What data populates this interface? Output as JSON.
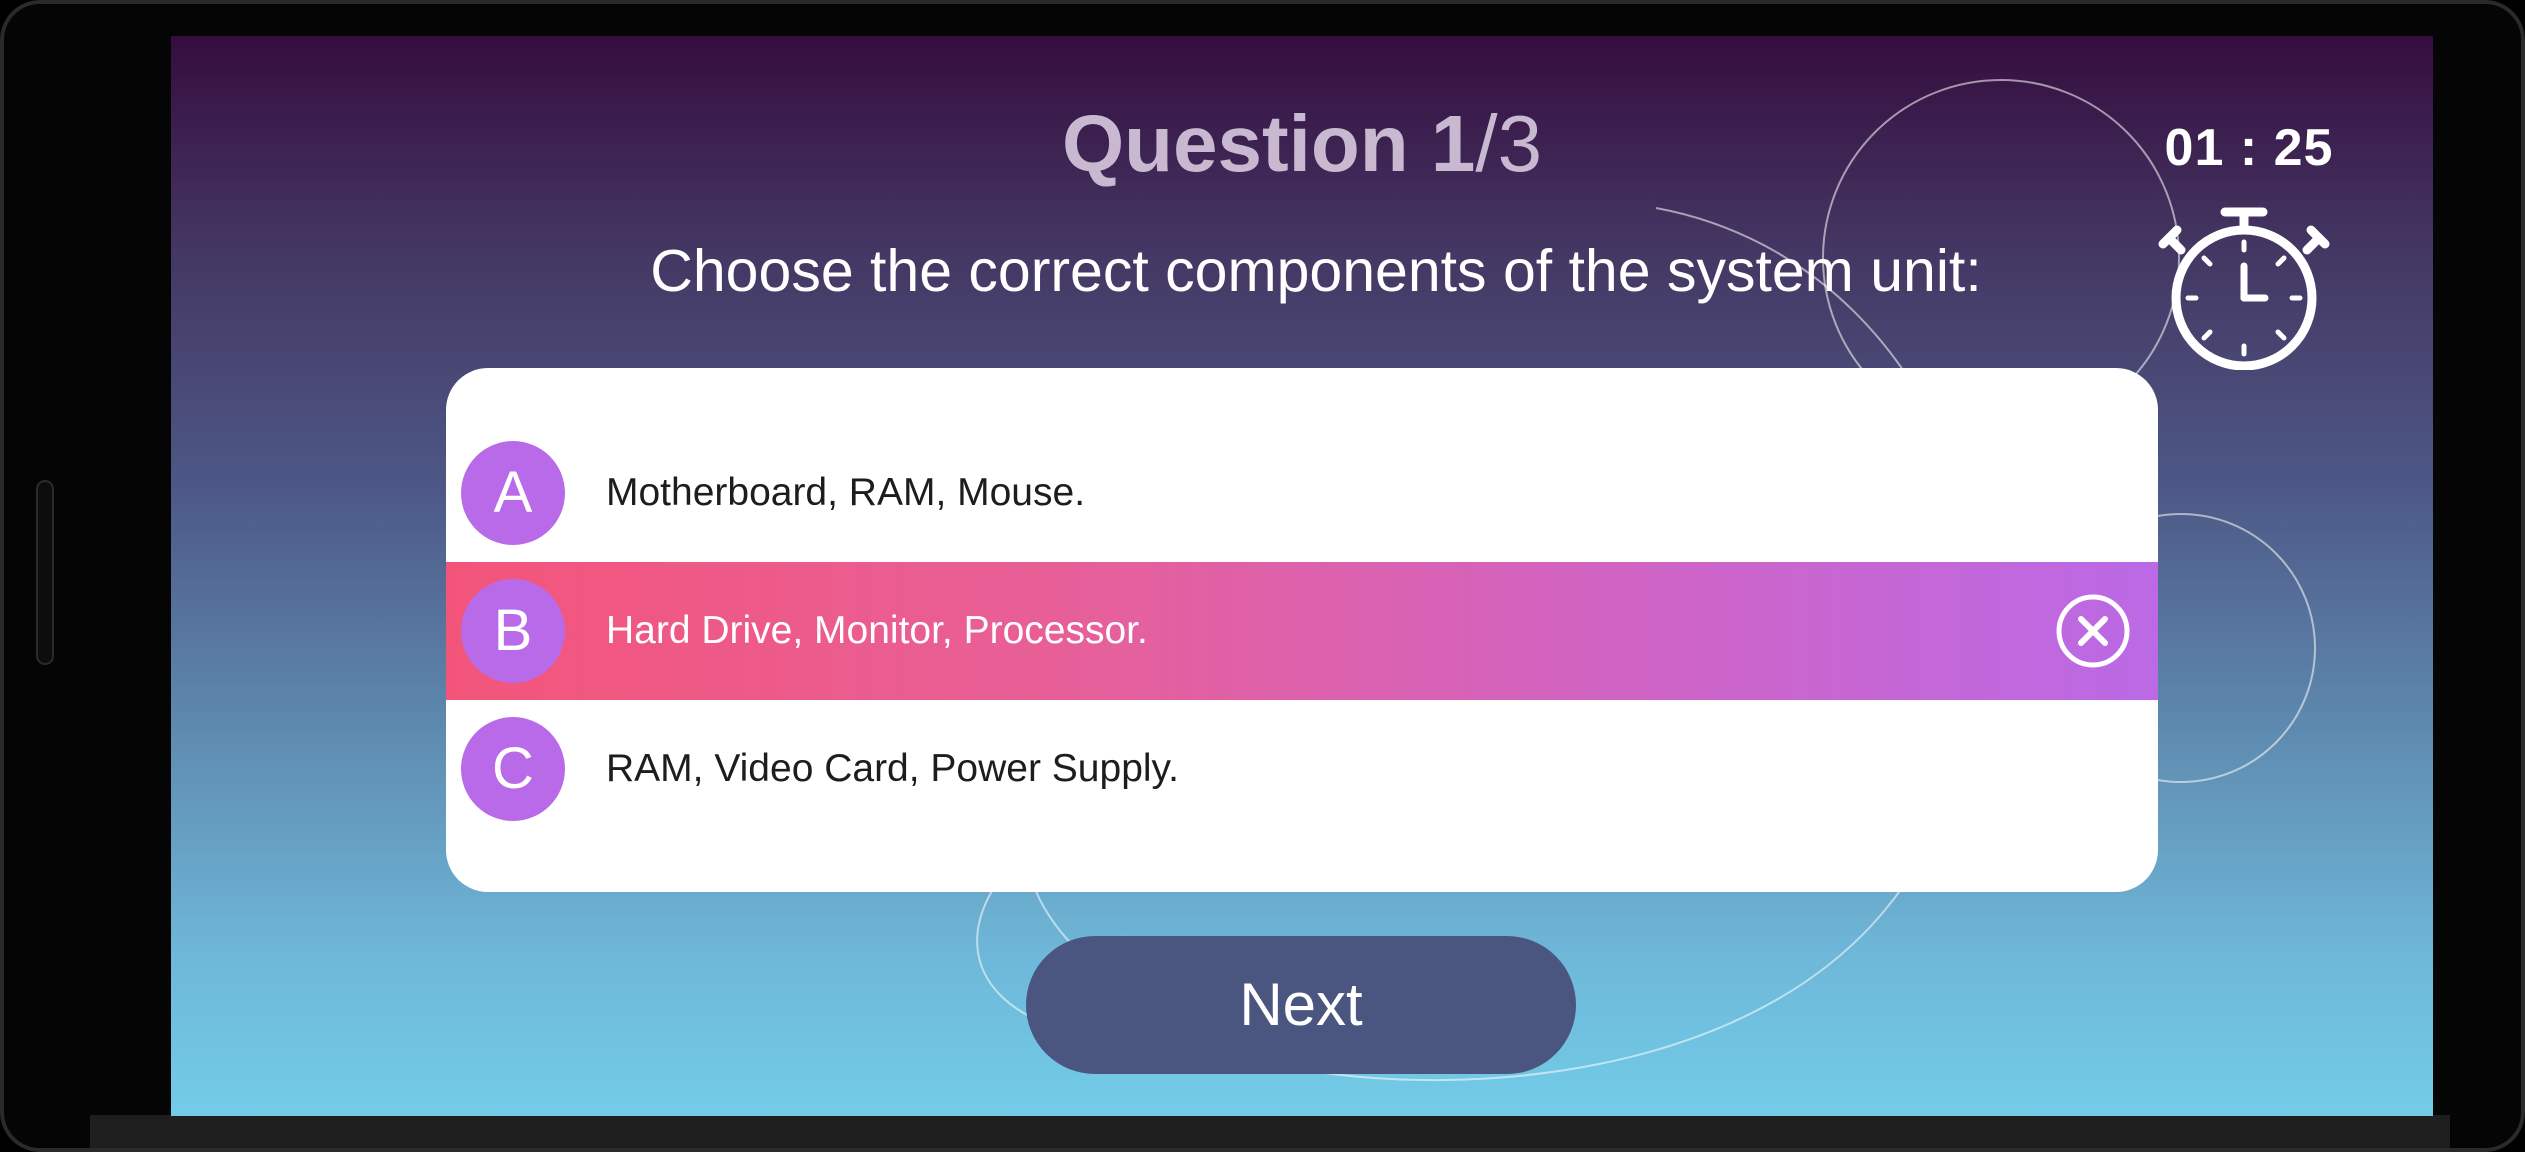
{
  "quiz": {
    "question_label": "Question 1",
    "question_total": "/3",
    "prompt": "Choose the correct components of the system unit:",
    "timer": "01 : 25",
    "timer_icon": "stopwatch-icon",
    "options": [
      {
        "letter": "A",
        "text": "Motherboard, RAM, Mouse.",
        "state": "default"
      },
      {
        "letter": "B",
        "text": "Hard Drive, Monitor, Processor.",
        "state": "wrong",
        "status_icon": "close-circle-icon"
      },
      {
        "letter": "C",
        "text": "RAM, Video Card, Power Supply.",
        "state": "default"
      }
    ],
    "next_label": "Next"
  },
  "colors": {
    "badge": "#b96ae8",
    "wrong_start": "#f3557a",
    "wrong_end": "#bb69e6",
    "next_button": "#4a5580",
    "background_top": "#350d3f",
    "background_bottom": "#72cce8"
  }
}
